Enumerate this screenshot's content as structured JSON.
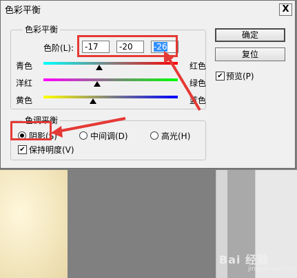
{
  "dialog": {
    "title": "色彩平衡",
    "close_symbol": "X"
  },
  "color_balance": {
    "group_label": "色彩平衡",
    "levels_label": "色阶(L):",
    "levels": [
      "-17",
      "-20",
      "-26"
    ],
    "sliders": [
      {
        "left": "青色",
        "right": "红色",
        "value": -17
      },
      {
        "left": "洋红",
        "right": "绿色",
        "value": -20
      },
      {
        "left": "黄色",
        "right": "蓝色",
        "value": -26
      }
    ]
  },
  "tone_balance": {
    "group_label": "色调平衡",
    "options": [
      "阴影(S)",
      "中间调(D)",
      "高光(H)"
    ],
    "selected": "阴影(S)",
    "preserve_luminosity_label": "保持明度(V)",
    "preserve_luminosity_checked": true
  },
  "buttons": {
    "ok": "确定",
    "reset": "复位"
  },
  "preview": {
    "label": "预览(P)",
    "checked": true
  },
  "watermark": {
    "text": "Bai 经验",
    "sub": "jingyan.baidu.com"
  },
  "annotation_color": "#e53935"
}
